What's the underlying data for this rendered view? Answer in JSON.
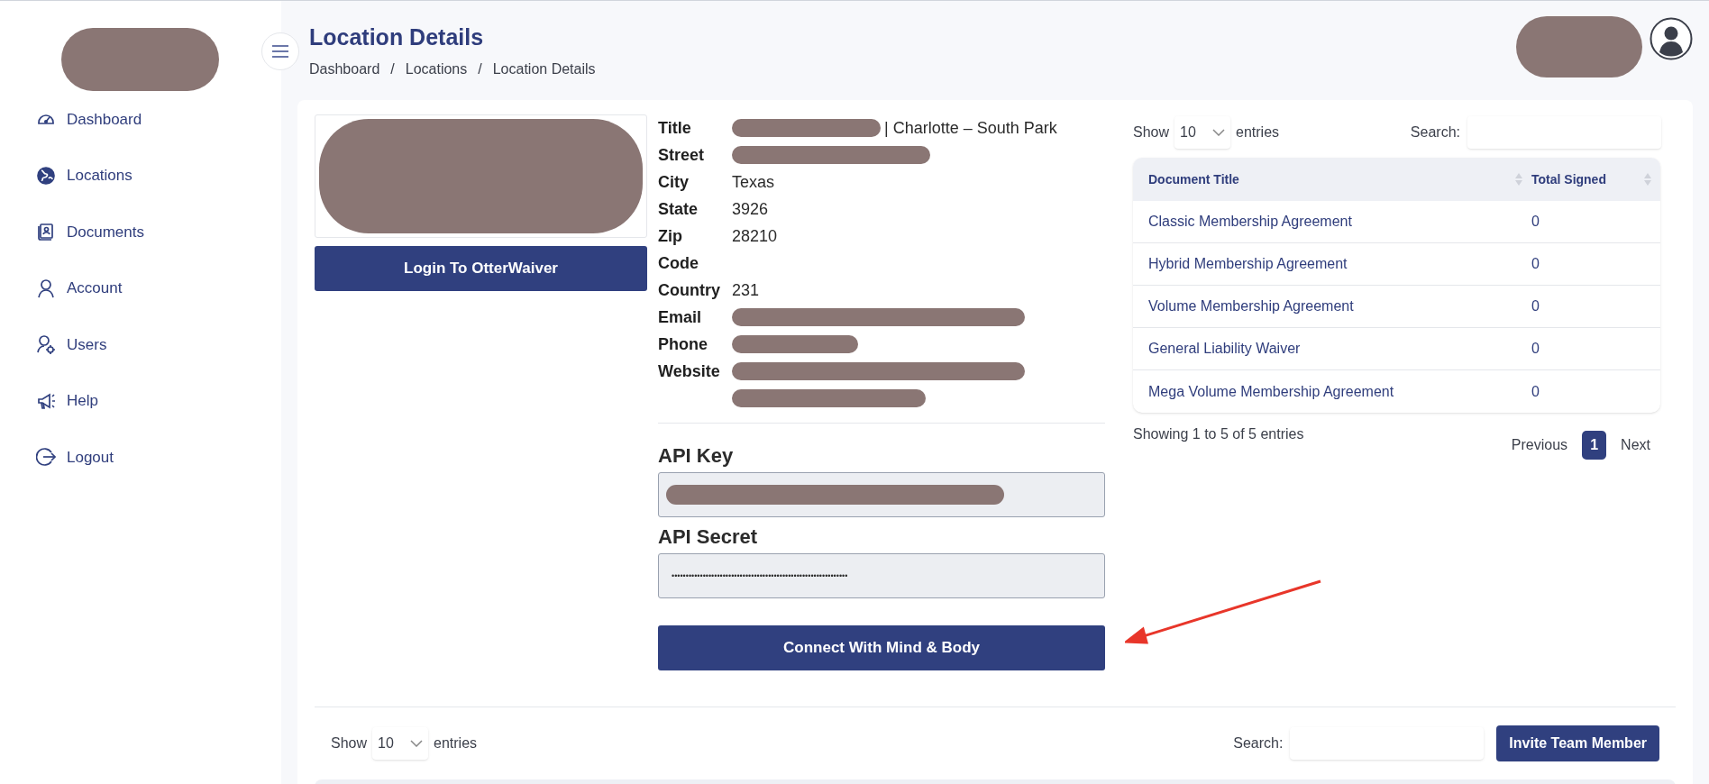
{
  "sidebar": {
    "items": [
      {
        "label": "Dashboard",
        "kind": "gauge"
      },
      {
        "label": "Locations",
        "kind": "globe"
      },
      {
        "label": "Documents",
        "kind": "book"
      },
      {
        "label": "Account",
        "kind": "person"
      },
      {
        "label": "Users",
        "kind": "person_gear"
      },
      {
        "label": "Help",
        "kind": "megaphone"
      },
      {
        "label": "Logout",
        "kind": "logout"
      }
    ]
  },
  "header": {
    "title": "Location Details",
    "breadcrumbs": [
      "Dashboard",
      "Locations",
      "Location Details"
    ],
    "separators": [
      "/",
      "/"
    ]
  },
  "location": {
    "login_button": "Login To OtterWaiver",
    "details": [
      {
        "label": "Title",
        "value": "| Charlotte – South Park",
        "redacted": true
      },
      {
        "label": "Street",
        "redacted": true
      },
      {
        "label": "City",
        "value": "Texas"
      },
      {
        "label": "State",
        "value": "3926"
      },
      {
        "label": "Zip",
        "value": "28210"
      },
      {
        "label": "Code"
      },
      {
        "label": "Country",
        "value": "231"
      },
      {
        "label": "Email",
        "redacted": true
      },
      {
        "label": "Phone",
        "redacted": true
      },
      {
        "label": "Website",
        "redacted": true,
        "wrapped": true
      }
    ],
    "api_key_label": "API Key",
    "api_secret_label": "API Secret",
    "api_secret_value": "••••••••••••••••••••••••••••••••••••••••••••••••••••••••••••••",
    "connect_button": "Connect With Mind & Body"
  },
  "documents_table": {
    "show_label": "Show",
    "page_length": "10",
    "entries_label": "entries",
    "search_label": "Search:",
    "columns": [
      "Document Title",
      "Total Signed"
    ],
    "rows": [
      [
        "Classic Membership Agreement",
        "0"
      ],
      [
        "Hybrid Membership Agreement",
        "0"
      ],
      [
        "Volume Membership Agreement",
        "0"
      ],
      [
        "General Liability Waiver",
        "0"
      ],
      [
        "Mega Volume Membership Agreement",
        "0"
      ]
    ],
    "info": "Showing 1 to 5 of 5 entries",
    "pagination": {
      "previous": "Previous",
      "pages": [
        {
          "label": "1",
          "selected": true
        }
      ],
      "next": "Next"
    }
  },
  "team_table": {
    "show_label": "Show",
    "page_length": "10",
    "entries_label": "entries",
    "search_label": "Search:",
    "invite_button": "Invite Team Member"
  }
}
